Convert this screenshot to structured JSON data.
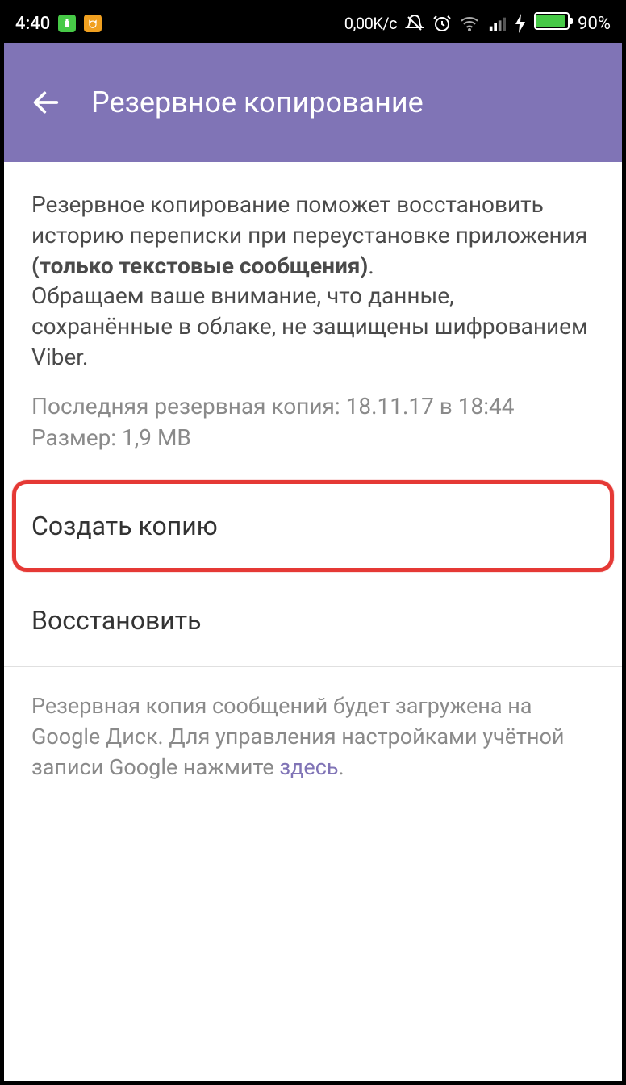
{
  "status": {
    "time": "4:40",
    "net_speed": "0,00K/c",
    "battery_percent": "90%"
  },
  "appbar": {
    "title": "Резервное копирование"
  },
  "info": {
    "desc_part1": "Резервное копирование поможет восстановить историю переписки при переустановке приложения ",
    "desc_bold": "(только текстовые сообщения)",
    "desc_part1_end": ".",
    "desc_part2": "Обращаем ваше внимание, что данные, сохранённые в облаке, не защищены шифрованием Viber.",
    "last_backup_label": "Последняя резервная копия:",
    "last_backup_value": "18.11.17 в 18:44",
    "size_label": "Размер:",
    "size_value": "1,9 MB"
  },
  "actions": {
    "create_backup": "Создать копию",
    "restore": "Восстановить"
  },
  "footer": {
    "text_part1": "Резервная копия сообщений будет загружена на Google Диск. Для управления настройками учётной записи Google нажмите ",
    "link_text": "здесь",
    "text_part2": "."
  }
}
